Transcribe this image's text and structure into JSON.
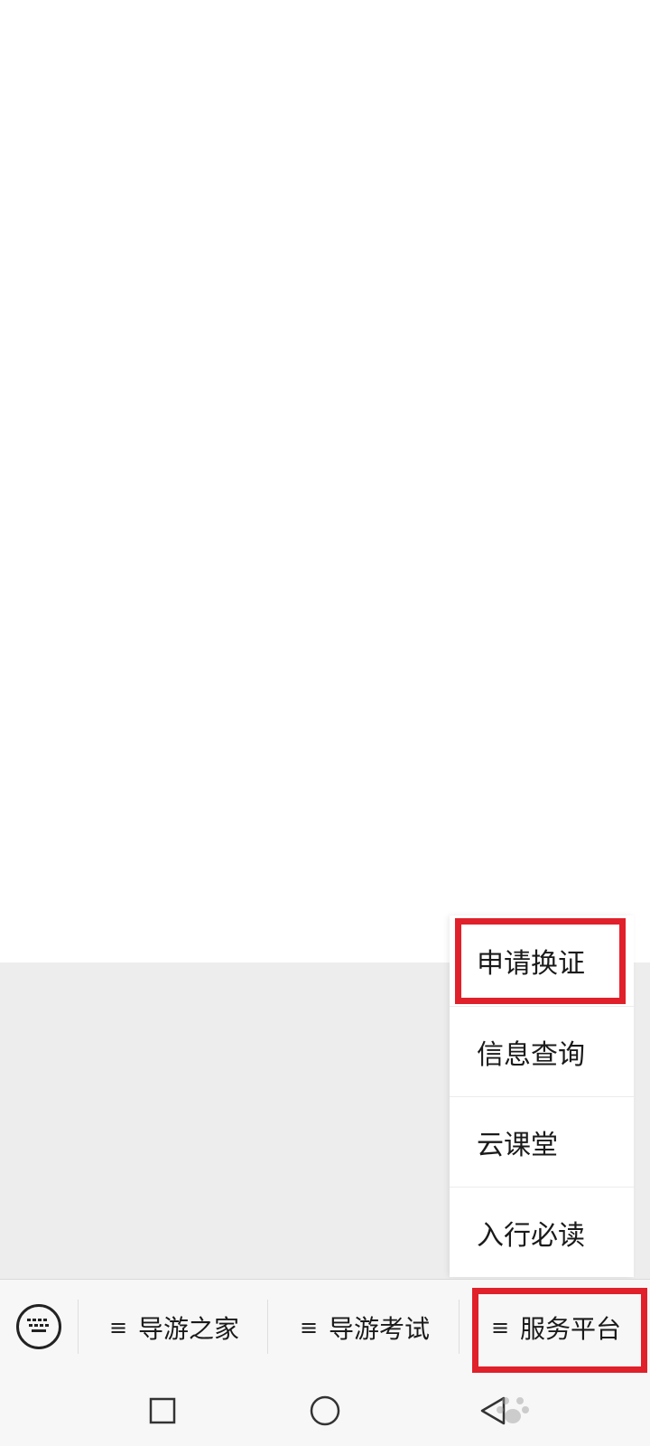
{
  "submenu": {
    "items": [
      {
        "label": "申请换证"
      },
      {
        "label": "信息查询"
      },
      {
        "label": "云课堂"
      },
      {
        "label": "入行必读"
      }
    ]
  },
  "menu_bar": {
    "keyboard_icon": "keyboard-icon",
    "tabs": [
      {
        "glyph": "≡",
        "label": "导游之家"
      },
      {
        "glyph": "≡",
        "label": "导游考试"
      },
      {
        "glyph": "≡",
        "label": "服务平台"
      }
    ]
  },
  "nav_bar": {
    "icons": [
      "recents-square-icon",
      "home-circle-icon",
      "back-triangle-icon"
    ]
  },
  "colors": {
    "highlight": "#e0202a",
    "panel_gray": "#ededed",
    "bar_bg": "#f7f7f7"
  }
}
